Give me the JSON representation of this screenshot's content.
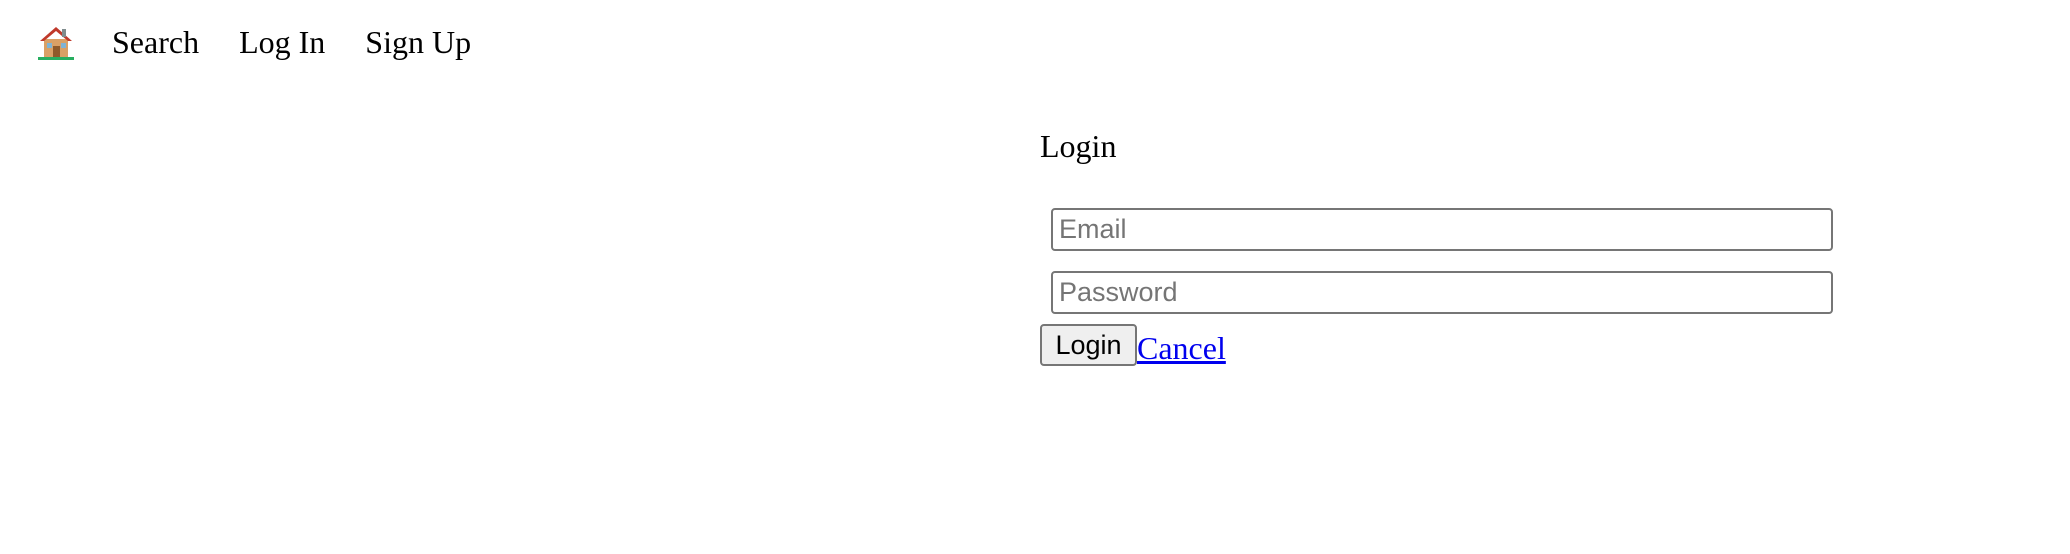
{
  "nav": {
    "home_icon": "house-icon",
    "items": [
      {
        "label": "Search"
      },
      {
        "label": "Log In"
      },
      {
        "label": "Sign Up"
      }
    ]
  },
  "login": {
    "title": "Login",
    "email_placeholder": "Email",
    "email_value": "",
    "password_placeholder": "Password",
    "password_value": "",
    "submit_label": "Login",
    "cancel_label": "Cancel"
  },
  "colors": {
    "link": "#0000ee",
    "text": "#000000",
    "button_bg": "#efefef",
    "border": "#767676"
  }
}
